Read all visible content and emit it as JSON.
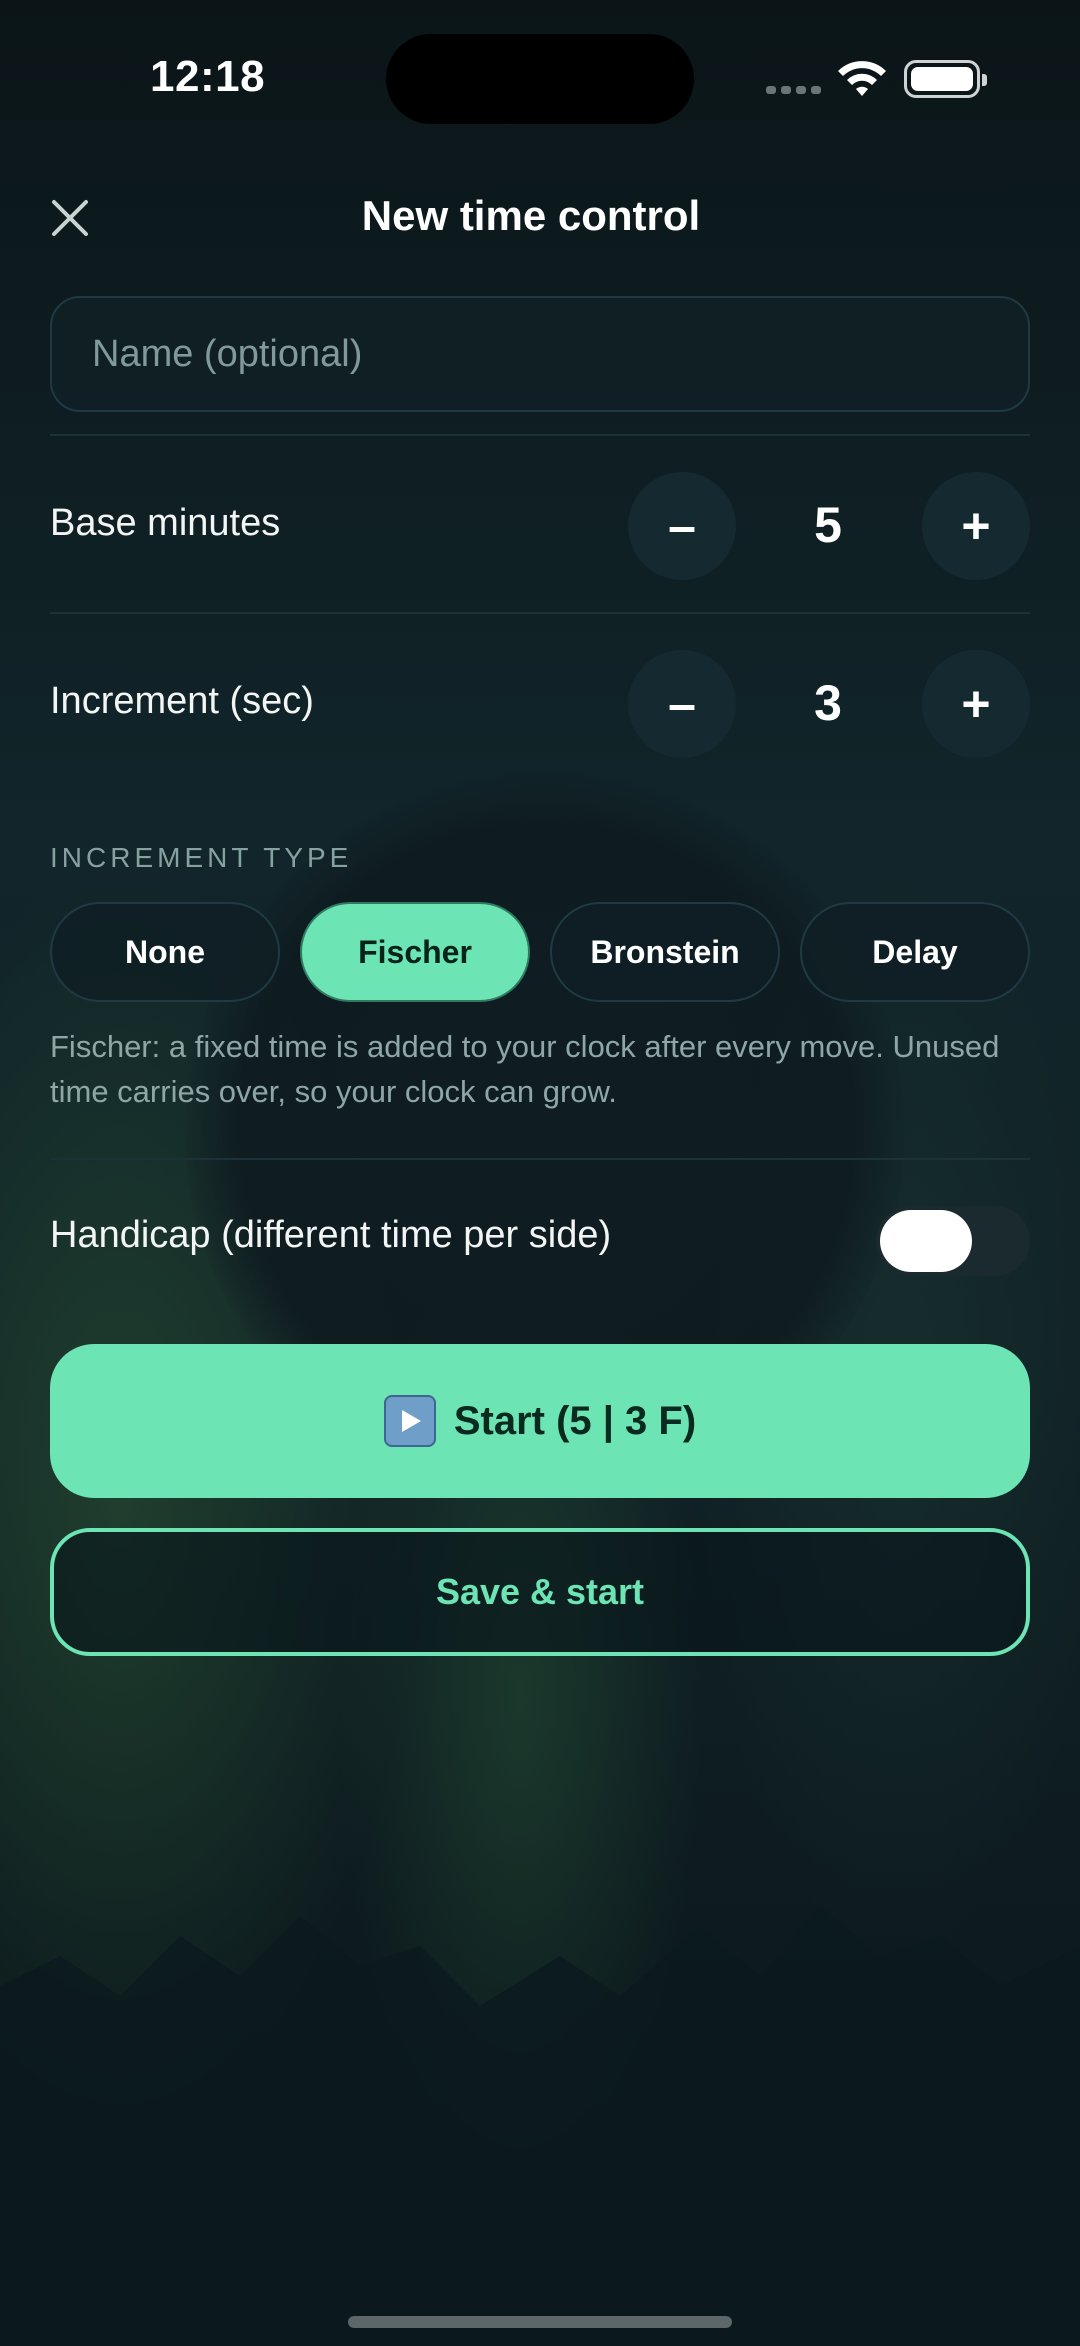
{
  "status_bar": {
    "time": "12:18"
  },
  "header": {
    "title": "New time control",
    "close_icon": "close-icon"
  },
  "name_field": {
    "placeholder": "Name (optional)",
    "value": ""
  },
  "base_minutes": {
    "label": "Base minutes",
    "value": "5",
    "decrement": "–",
    "increment": "+"
  },
  "increment_sec": {
    "label": "Increment (sec)",
    "value": "3",
    "decrement": "–",
    "increment": "+"
  },
  "increment_type": {
    "section_title": "INCREMENT TYPE",
    "options": [
      "None",
      "Fischer",
      "Bronstein",
      "Delay"
    ],
    "selected": "Fischer",
    "description": "Fischer: a fixed time is added to your clock after every move. Unused time carries over, so your clock can grow."
  },
  "handicap": {
    "label": "Handicap (different time per side)",
    "enabled": false
  },
  "actions": {
    "start_label": "Start (5 | 3 F)",
    "start_icon": "play-icon",
    "save_label": "Save & start"
  },
  "colors": {
    "accent": "#6ce4b4",
    "background": "#0d1a1e",
    "muted_text": "#8ea6a5"
  }
}
